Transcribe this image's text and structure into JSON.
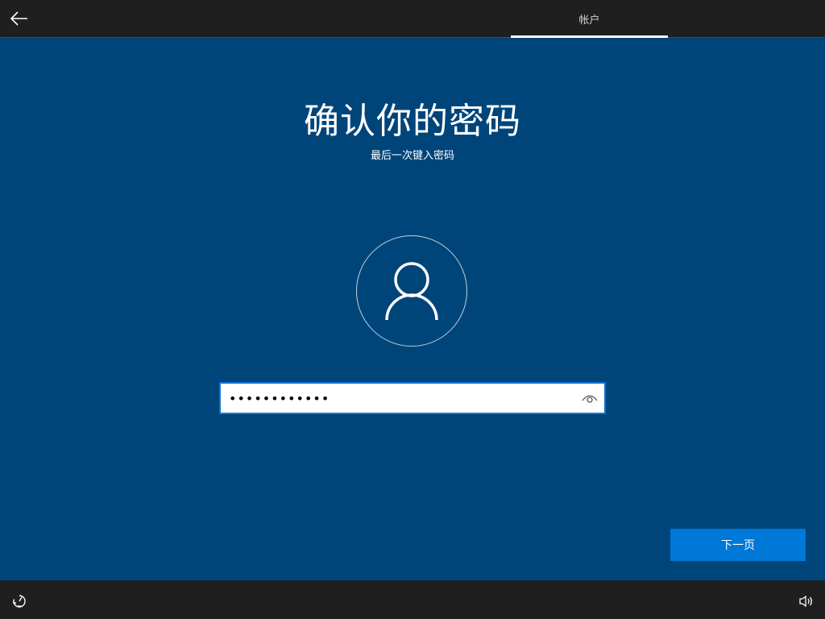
{
  "header": {
    "back_icon": "arrow-left-icon",
    "tab_label": "帐户"
  },
  "main": {
    "title": "确认你的密码",
    "subtitle": "最后一次键入密码",
    "avatar_icon": "user-icon",
    "password": {
      "value": "••••••••••••",
      "reveal_icon": "eye-icon"
    },
    "next_label": "下一页"
  },
  "footer": {
    "ease_of_access_icon": "ease-of-access-icon",
    "volume_icon": "speaker-icon"
  },
  "colors": {
    "background": "#00457a",
    "bar": "#1f1f1f",
    "accent": "#0078d7",
    "input_border": "#0a74d4"
  }
}
